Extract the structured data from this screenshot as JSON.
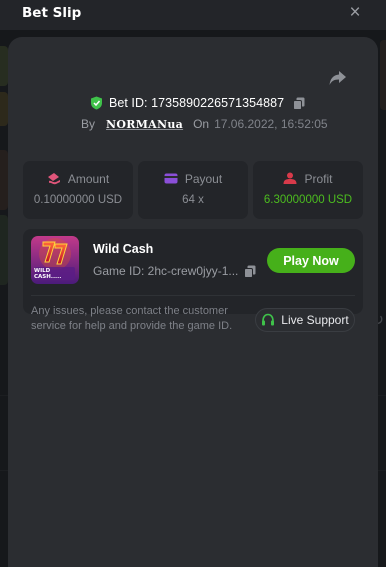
{
  "modal": {
    "title": "Bet Slip",
    "close_icon": "close-icon"
  },
  "bet": {
    "id_text": "Bet ID: 1735890226571354887",
    "by_label": "By",
    "user_name": "NORMANua",
    "on_label": "On",
    "date": "17.06.2022, 16:52:05"
  },
  "stats": [
    {
      "label": "Amount",
      "value": "0.10000000 USD",
      "icon": "money-icon",
      "icon_color": "#e0557a"
    },
    {
      "label": "Payout",
      "value": "64 x",
      "icon": "wallet-icon",
      "icon_color": "#8b4fd8"
    },
    {
      "label": "Profit",
      "value": "6.30000000 USD",
      "icon": "profit-icon",
      "icon_color": "#d83a4a"
    }
  ],
  "game": {
    "name": "Wild Cash",
    "id_text": "Game ID: 2hc-crew0jyy-1...",
    "thumb_label": "WILD CASH.....",
    "play_label": "Play Now"
  },
  "support": {
    "help_text": "Any issues, please contact the customer service for help and provide the game ID.",
    "button_label": "Live Support"
  },
  "colors": {
    "accent_green": "#46b01a",
    "profit_green": "#4cbd1f",
    "shield_green": "#3fc24a",
    "panel": "#2b2d31",
    "card": "#232529"
  }
}
